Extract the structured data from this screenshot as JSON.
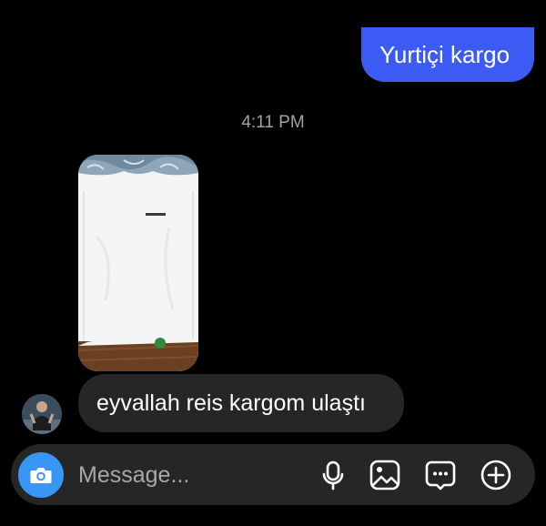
{
  "conversation": {
    "sent_message": "Yurtiçi kargo",
    "timestamp": "4:11 PM",
    "photo_description_icon": "photo-attachment",
    "received_message": "eyvallah reis kargom ulaştı"
  },
  "composer": {
    "placeholder": "Message...",
    "icons": [
      "camera-icon",
      "microphone-icon",
      "gallery-icon",
      "sticker-icon",
      "plus-icon"
    ]
  },
  "colors": {
    "background": "#000000",
    "sent_bubble": "#3c5bf5",
    "received_bubble": "#262626",
    "camera_button": "#3896f6",
    "timestamp": "#a3a3a3"
  }
}
